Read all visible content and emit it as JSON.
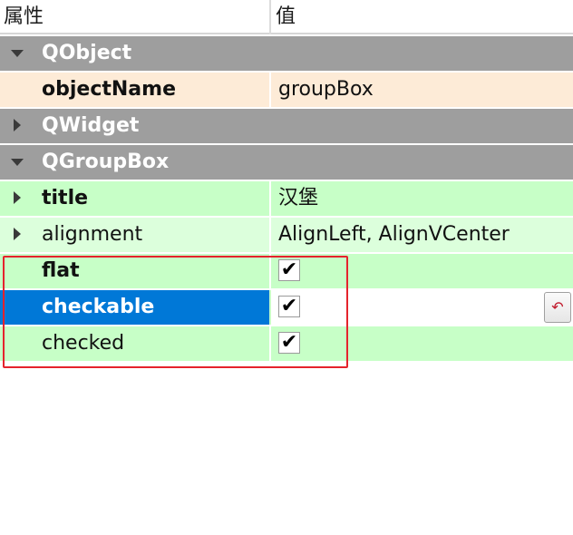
{
  "header": {
    "col_property": "属性",
    "col_value": "值"
  },
  "rows": [
    {
      "name": "QObject",
      "type": "group",
      "expanded": true
    },
    {
      "name": "objectName",
      "value": "groupBox"
    },
    {
      "name": "QWidget",
      "type": "group",
      "expanded": false
    },
    {
      "name": "QGroupBox",
      "type": "group",
      "expanded": true
    },
    {
      "name": "title",
      "value": "汉堡",
      "expandable": true
    },
    {
      "name": "alignment",
      "value": "AlignLeft, AlignVCenter",
      "expandable": true
    },
    {
      "name": "flat",
      "checked": true
    },
    {
      "name": "checkable",
      "checked": true,
      "selected": true
    },
    {
      "name": "checked",
      "checked": true
    }
  ],
  "check_glyph": "✔",
  "reset_glyph": "↶",
  "colors": {
    "group_header": "#9e9e9e",
    "qobject_row": "#fdebd7",
    "qgroupbox_row": "#c7ffc7",
    "selection": "#0078d7",
    "annotation": "#e5232d"
  }
}
